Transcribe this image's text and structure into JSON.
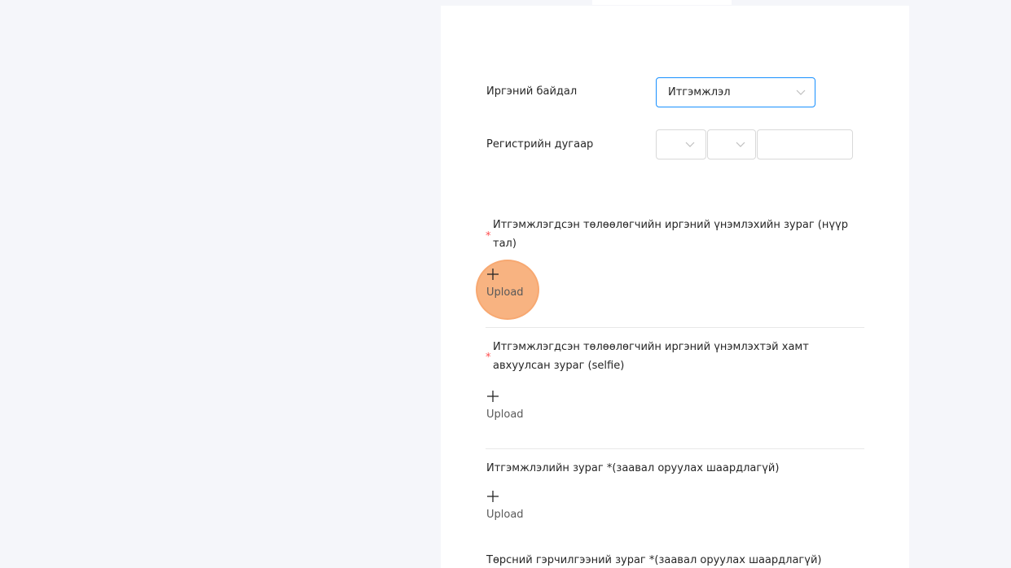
{
  "form": {
    "citizen_status": {
      "label": "Иргэний байдал",
      "value": "Итгэмжлэл"
    },
    "registration_number": {
      "label": "Регистрийн дугаар"
    },
    "uploads": [
      {
        "required_mark": "*",
        "title": "Итгэмжлэгдсэн төлөөлөгчийн иргэний үнэмлэхийн зураг (нүүр тал)",
        "button_label": "Upload"
      },
      {
        "required_mark": "*",
        "title": "Итгэмжлэгдсэн төлөөлөгчийн иргэний үнэмлэхтэй хамт авхуулсан зураг (selfie)",
        "button_label": "Upload"
      },
      {
        "title": "Итгэмжлэлийн зураг *(заавал оруулах шаардлагүй)",
        "button_label": "Upload"
      },
      {
        "title": "Төрсний гэрчилгээний зураг *(заавал оруулах шаардлагүй)"
      }
    ]
  },
  "colors": {
    "accent": "#1890ff",
    "required": "#ff4d4f",
    "click_indicator": "#f59650"
  }
}
